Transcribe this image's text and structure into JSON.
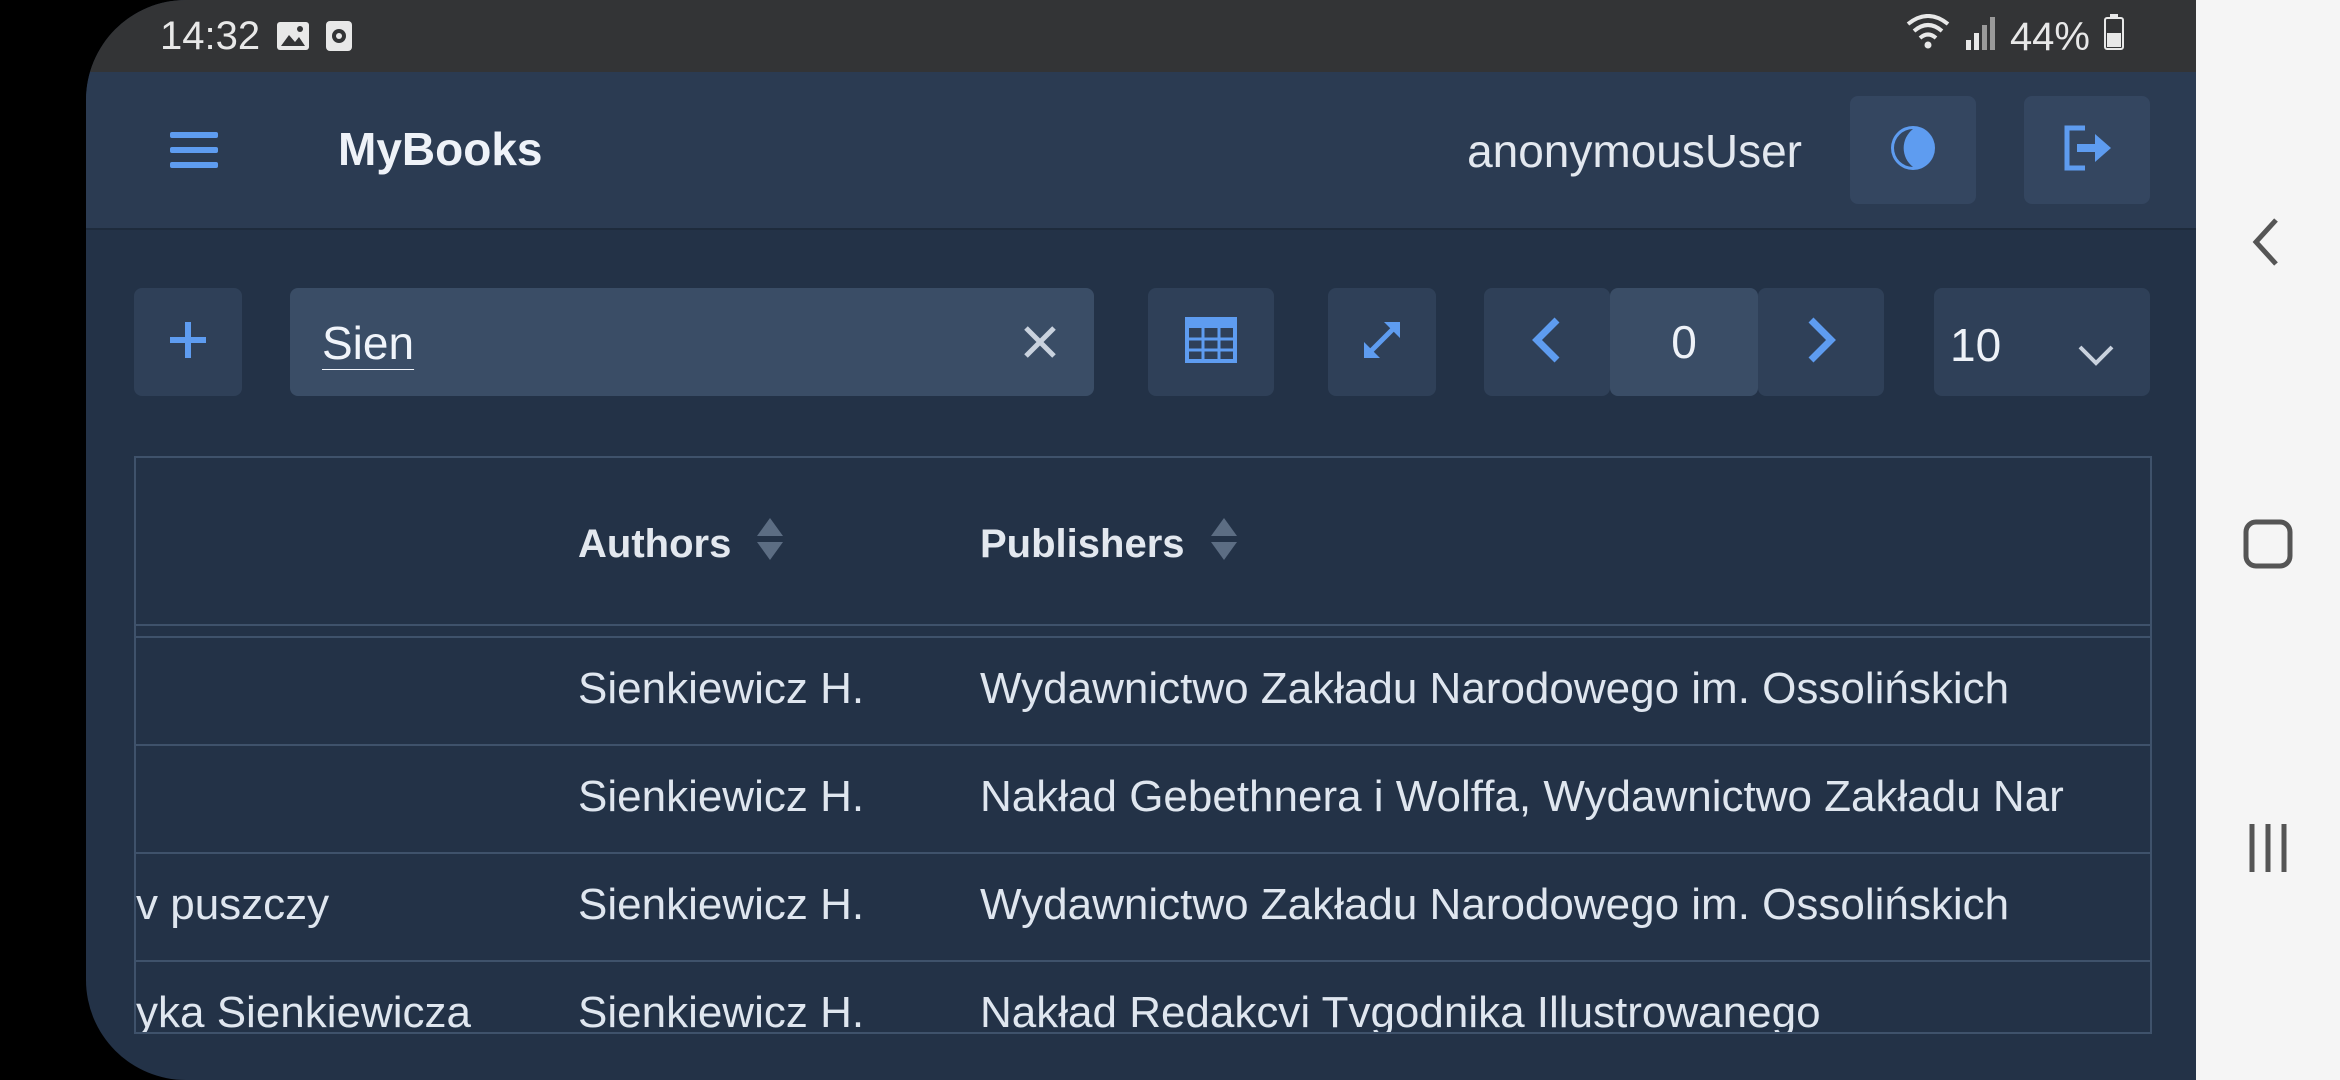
{
  "status_bar": {
    "time": "14:32",
    "battery": "44%"
  },
  "app_bar": {
    "title": "MyBooks",
    "username": "anonymousUser"
  },
  "search": {
    "value": "Sien",
    "placeholder": ""
  },
  "pagination": {
    "page": "0",
    "page_size": "10"
  },
  "table": {
    "headers": [
      "Authors",
      "Publishers"
    ],
    "rows": [
      {
        "title": "",
        "authors": "Sienkiewicz H.",
        "publishers": "Wydawnictwo Zakładu Narodowego im. Ossolińskich"
      },
      {
        "title": "",
        "authors": "Sienkiewicz H.",
        "publishers": "Nakład Gebethnera i Wolffa, Wydawnictwo Zakładu Nar"
      },
      {
        "title": "v puszczy",
        "authors": "Sienkiewicz H.",
        "publishers": "Wydawnictwo Zakładu Narodowego im. Ossolińskich"
      },
      {
        "title": "yka Sienkiewicza",
        "authors": "Sienkiewicz H.",
        "publishers": "Nakład Redakcvi Tvgodnika Illustrowanego"
      }
    ]
  },
  "colors": {
    "accent": "#5e9cf0",
    "background": "#233247",
    "appbar": "#2b3b52"
  }
}
